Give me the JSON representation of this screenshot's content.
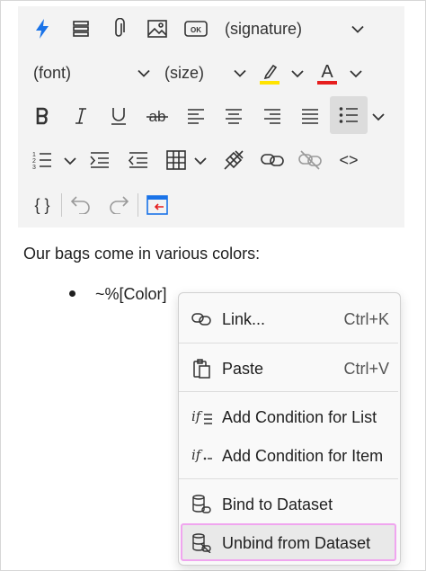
{
  "toolbar": {
    "signature_select": "(signature)",
    "font_select": "(font)",
    "size_select": "(size)",
    "highlight_color": "#ffe300",
    "font_color": "#e61e1e",
    "font_color_glyph": "A",
    "curly_glyph": "{ }",
    "code_glyph": "<>",
    "icons": [
      "lightning-icon",
      "fields-icon",
      "attachment-icon",
      "image-icon",
      "ok-button-icon",
      "highlight-icon",
      "font-color-icon",
      "bold-icon",
      "italic-icon",
      "underline-icon",
      "strikethrough-icon",
      "align-left-icon",
      "align-center-icon",
      "align-right-icon",
      "justify-icon",
      "bullet-list-icon",
      "numbered-list-icon",
      "indent-icon",
      "outdent-icon",
      "table-icon",
      "clear-format-icon",
      "link-icon",
      "unlink-icon",
      "code-icon",
      "braces-icon",
      "undo-icon",
      "redo-icon",
      "insert-field-icon"
    ]
  },
  "editor": {
    "paragraph": "Our bags come in various colors:",
    "bullet_item": "~%[Color]"
  },
  "context_menu": {
    "items": [
      {
        "label": "Link...",
        "shortcut": "Ctrl+K",
        "icon": "link-icon"
      },
      {
        "label": "Paste",
        "shortcut": "Ctrl+V",
        "icon": "paste-icon"
      },
      {
        "label": "Add Condition for List",
        "icon": "condition-list-icon"
      },
      {
        "label": "Add Condition for Item",
        "icon": "condition-item-icon"
      },
      {
        "label": "Bind to Dataset",
        "icon": "bind-dataset-icon"
      },
      {
        "label": "Unbind from Dataset",
        "icon": "unbind-dataset-icon"
      }
    ],
    "highlight_border": "#f0a5ef"
  }
}
